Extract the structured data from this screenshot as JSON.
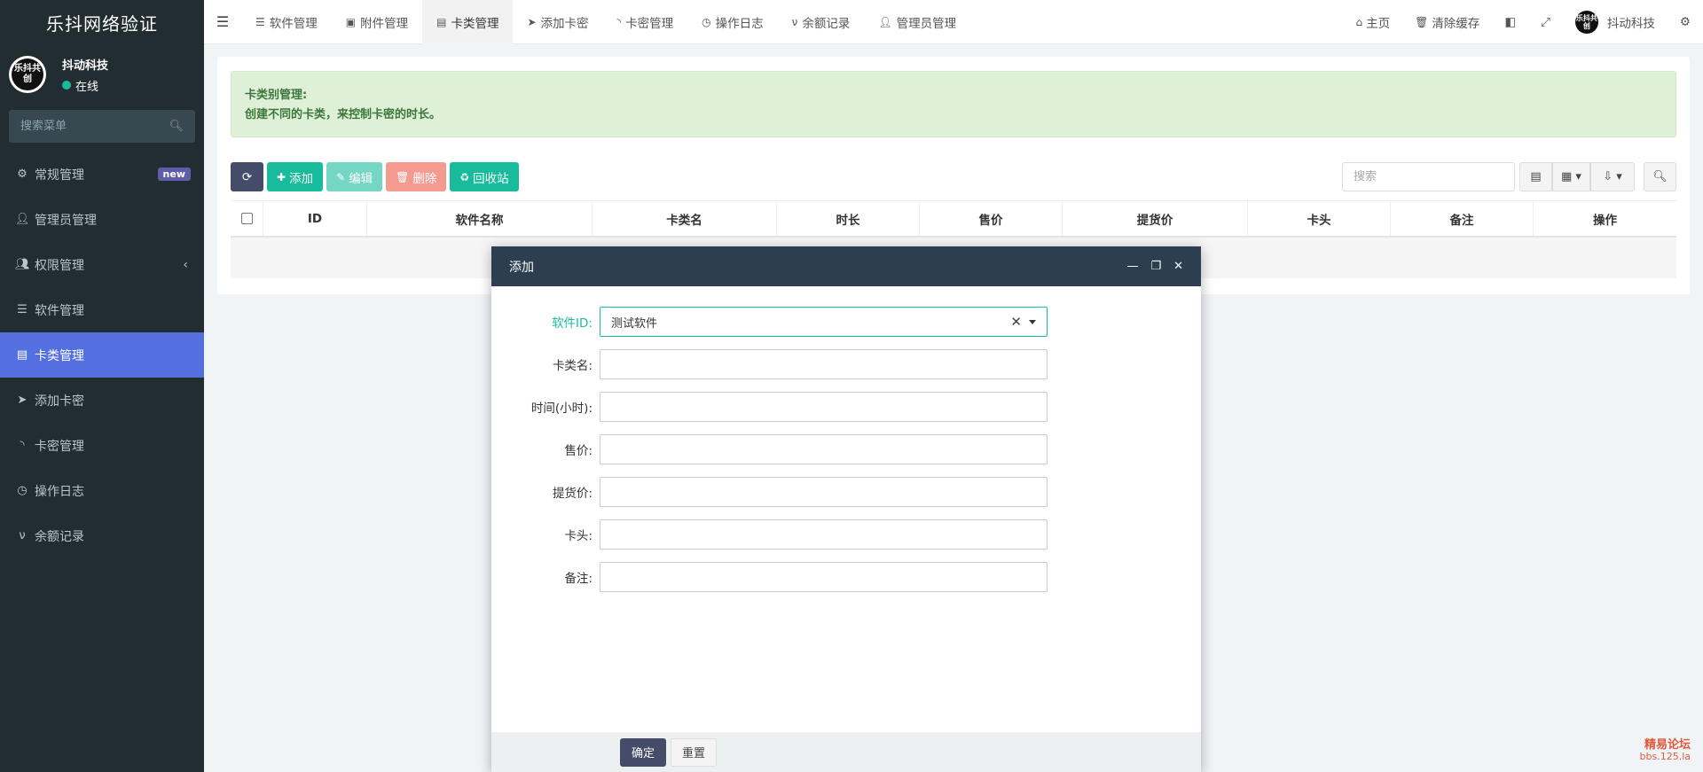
{
  "sidebar": {
    "logo": "乐抖网络验证",
    "user": {
      "name": "抖动科技",
      "status": "在线",
      "avatar_text": "乐抖共创"
    },
    "search_placeholder": "搜索菜单",
    "items": [
      {
        "label": "常规管理",
        "icon": "cogs-icon",
        "badge": "new"
      },
      {
        "label": "管理员管理",
        "icon": "user-icon"
      },
      {
        "label": "权限管理",
        "icon": "group-icon",
        "chevron": "‹"
      },
      {
        "label": "软件管理",
        "icon": "list-icon"
      },
      {
        "label": "卡类管理",
        "icon": "card-icon",
        "active": true
      },
      {
        "label": "添加卡密",
        "icon": "paper-plane-icon"
      },
      {
        "label": "卡密管理",
        "icon": "rss-icon"
      },
      {
        "label": "操作日志",
        "icon": "clock-icon"
      },
      {
        "label": "余额记录",
        "icon": "vimeo-icon"
      }
    ]
  },
  "topbar": {
    "tabs": [
      {
        "label": "软件管理",
        "icon": "list-icon"
      },
      {
        "label": "附件管理",
        "icon": "image-icon"
      },
      {
        "label": "卡类管理",
        "icon": "card-icon",
        "active": true
      },
      {
        "label": "添加卡密",
        "icon": "paper-plane-icon"
      },
      {
        "label": "卡密管理",
        "icon": "rss-icon"
      },
      {
        "label": "操作日志",
        "icon": "clock-icon"
      },
      {
        "label": "余额记录",
        "icon": "vimeo-icon"
      },
      {
        "label": "管理员管理",
        "icon": "user-icon"
      }
    ],
    "home": "主页",
    "clear_cache": "清除缓存",
    "user_name": "抖动科技",
    "avatar_text": "乐抖共创"
  },
  "alert": {
    "title": "卡类别管理:",
    "text": "创建不同的卡类，来控制卡密的时长。"
  },
  "toolbar": {
    "add": "添加",
    "edit": "编辑",
    "delete": "删除",
    "recycle": "回收站",
    "search_placeholder": "搜索"
  },
  "table": {
    "headers": [
      "ID",
      "软件名称",
      "卡类名",
      "时长",
      "售价",
      "提货价",
      "卡头",
      "备注",
      "操作"
    ]
  },
  "modal": {
    "title": "添加",
    "fields": [
      {
        "label": "软件ID:",
        "value": "测试软件",
        "type": "select"
      },
      {
        "label": "卡类名:",
        "value": ""
      },
      {
        "label": "时间(小时):",
        "value": ""
      },
      {
        "label": "售价:",
        "value": ""
      },
      {
        "label": "提货价:",
        "value": ""
      },
      {
        "label": "卡头:",
        "value": ""
      },
      {
        "label": "备注:",
        "value": ""
      }
    ],
    "confirm": "确定",
    "reset": "重置"
  },
  "watermark": {
    "line1": "精易论坛",
    "line2": "bbs.125.la"
  },
  "colors": {
    "sidebar_bg": "#222d32",
    "active": "#5470e0",
    "success": "#18bc9c",
    "modal_head": "#2c3e50",
    "primary_dark": "#444c69"
  }
}
